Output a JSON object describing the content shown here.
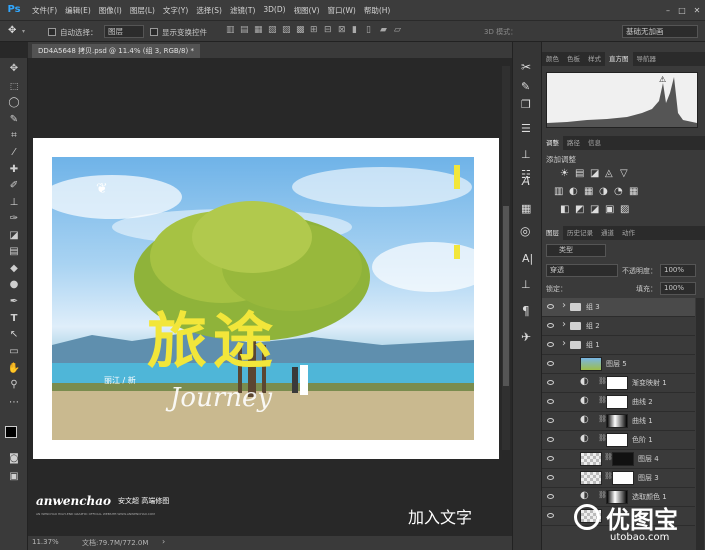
{
  "app": {
    "logo": "Ps"
  },
  "menu": [
    "文件(F)",
    "编辑(E)",
    "图像(I)",
    "图层(L)",
    "文字(Y)",
    "选择(S)",
    "滤镜(T)",
    "3D(D)",
    "视图(V)",
    "窗口(W)",
    "帮助(H)"
  ],
  "options": {
    "auto_select_label": "自动选择：",
    "auto_select_value": "图层",
    "show_transform_label": "显示变换控件",
    "mode_3d": "3D 模式：",
    "workspace": "基础无加画"
  },
  "document": {
    "tab_title": "DD4A5648 拷贝.psd @ 11.4% (组 3, RGB/8) *",
    "zoom": "11.37%",
    "doc_size": "文档:79.7M/772.0M"
  },
  "artwork": {
    "title": "旅途",
    "script": "Journey",
    "sub": "丽江 / 新",
    "brand": "anwenchao",
    "brand_cn": "安文超 高端修图",
    "brand_small": "AN WENCHAO HIGH-END GRAPHIC OFFICIAL WEBSITE:WWW.ANWENCHAO.COM",
    "caption": "加入文字"
  },
  "panels": {
    "top_tabs": [
      "颜色",
      "色板",
      "样式",
      "直方图",
      "导航器"
    ],
    "adjust_tabs": [
      "调整",
      "路径",
      "信息"
    ],
    "adjust_title": "添加调整",
    "layer_tabs": [
      "图层",
      "历史记录",
      "通道",
      "动作"
    ],
    "kind_label": "类型",
    "blend_mode": "穿透",
    "opacity_label": "不透明度：",
    "opacity_value": "100%",
    "lock_label": "锁定：",
    "fill_label": "填充：",
    "fill_value": "100%"
  },
  "layers": [
    {
      "name": "组 3",
      "type": "group"
    },
    {
      "name": "组 2",
      "type": "group"
    },
    {
      "name": "组 1",
      "type": "group"
    },
    {
      "name": "图层 5",
      "type": "image"
    },
    {
      "name": "渐变映射 1",
      "type": "adjust"
    },
    {
      "name": "曲线 2",
      "type": "adjust"
    },
    {
      "name": "曲线 1",
      "type": "adjust"
    },
    {
      "name": "色阶 1",
      "type": "adjust"
    },
    {
      "name": "图层 4",
      "type": "image"
    },
    {
      "name": "图层 3",
      "type": "image"
    },
    {
      "name": "选取颜色 1",
      "type": "adjust"
    },
    {
      "name": "",
      "type": "image"
    }
  ],
  "watermark": {
    "cn": "优图宝",
    "url": "utobao.com"
  },
  "colors": {
    "accent": "#31a8ff",
    "title_yellow": "#f2e63a"
  }
}
